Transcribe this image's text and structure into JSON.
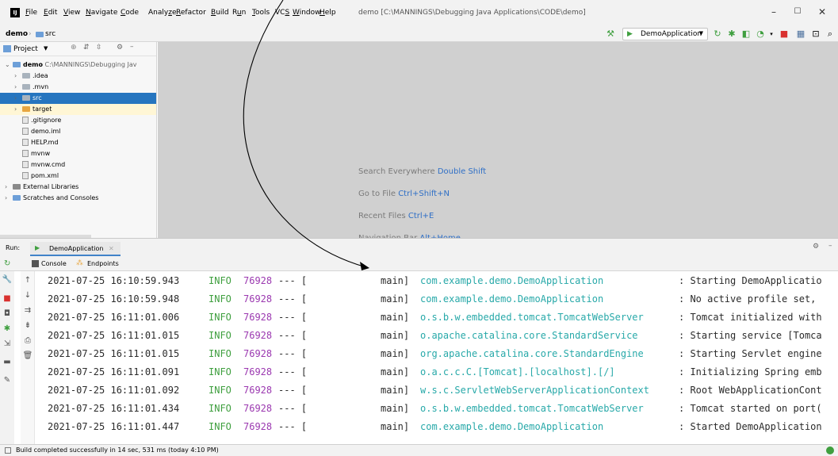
{
  "menu": {
    "items": [
      {
        "pre": "",
        "u": "F",
        "post": "ile"
      },
      {
        "pre": "",
        "u": "E",
        "post": "dit"
      },
      {
        "pre": "",
        "u": "V",
        "post": "iew"
      },
      {
        "pre": "",
        "u": "N",
        "post": "avigate"
      },
      {
        "pre": "",
        "u": "C",
        "post": "ode"
      },
      {
        "pre": "Analy",
        "u": "z",
        "post": "e"
      },
      {
        "pre": "",
        "u": "R",
        "post": "efactor"
      },
      {
        "pre": "",
        "u": "B",
        "post": "uild"
      },
      {
        "pre": "R",
        "u": "u",
        "post": "n"
      },
      {
        "pre": "",
        "u": "T",
        "post": "ools"
      },
      {
        "pre": "VC",
        "u": "S",
        "post": ""
      },
      {
        "pre": "",
        "u": "W",
        "post": "indow"
      },
      {
        "pre": "",
        "u": "H",
        "post": "elp"
      }
    ],
    "window_path": "demo [C:\\MANNINGS\\Debugging Java Applications\\CODE\\demo]",
    "minimize": "–",
    "maximize": "☐",
    "close": "✕"
  },
  "breadcrumb": {
    "project": "demo",
    "folder": "src"
  },
  "toolbar": {
    "run_config": "DemoApplication"
  },
  "project_panel": {
    "title": "Project",
    "rows": [
      {
        "label": "demo",
        "suffix": " C:\\MANNINGS\\Debugging Jav",
        "kind": "root"
      },
      {
        "label": ".idea",
        "kind": "folder"
      },
      {
        "label": ".mvn",
        "kind": "folder"
      },
      {
        "label": "src",
        "kind": "folder-selected"
      },
      {
        "label": "target",
        "kind": "folder-target"
      },
      {
        "label": ".gitignore",
        "kind": "file"
      },
      {
        "label": "demo.iml",
        "kind": "file"
      },
      {
        "label": "HELP.md",
        "kind": "file"
      },
      {
        "label": "mvnw",
        "kind": "file"
      },
      {
        "label": "mvnw.cmd",
        "kind": "file"
      },
      {
        "label": "pom.xml",
        "kind": "file"
      },
      {
        "label": "External Libraries",
        "kind": "lib"
      },
      {
        "label": "Scratches and Consoles",
        "kind": "scratch"
      }
    ]
  },
  "editor_hints": [
    {
      "text": "Search Everywhere ",
      "key": "Double Shift"
    },
    {
      "text": "Go to File ",
      "key": "Ctrl+Shift+N"
    },
    {
      "text": "Recent Files ",
      "key": "Ctrl+E"
    },
    {
      "text": "Navigation Bar ",
      "key": "Alt+Home"
    }
  ],
  "run_panel": {
    "label": "Run:",
    "tab": "DemoApplication",
    "subtabs": [
      "Console",
      "Endpoints"
    ]
  },
  "log": [
    {
      "time": "2021-07-25 16:10:59.943",
      "level": "INFO",
      "pid": "76928",
      "sep": "--- [",
      "thread": "main]",
      "logger": "com.example.demo.DemoApplication",
      "msg": ": Starting DemoApplicatio"
    },
    {
      "time": "2021-07-25 16:10:59.948",
      "level": "INFO",
      "pid": "76928",
      "sep": "--- [",
      "thread": "main]",
      "logger": "com.example.demo.DemoApplication",
      "msg": ": No active profile set,"
    },
    {
      "time": "2021-07-25 16:11:01.006",
      "level": "INFO",
      "pid": "76928",
      "sep": "--- [",
      "thread": "main]",
      "logger": "o.s.b.w.embedded.tomcat.TomcatWebServer",
      "msg": ": Tomcat initialized with"
    },
    {
      "time": "2021-07-25 16:11:01.015",
      "level": "INFO",
      "pid": "76928",
      "sep": "--- [",
      "thread": "main]",
      "logger": "o.apache.catalina.core.StandardService",
      "msg": ": Starting service [Tomca"
    },
    {
      "time": "2021-07-25 16:11:01.015",
      "level": "INFO",
      "pid": "76928",
      "sep": "--- [",
      "thread": "main]",
      "logger": "org.apache.catalina.core.StandardEngine",
      "msg": ": Starting Servlet engine"
    },
    {
      "time": "2021-07-25 16:11:01.091",
      "level": "INFO",
      "pid": "76928",
      "sep": "--- [",
      "thread": "main]",
      "logger": "o.a.c.c.C.[Tomcat].[localhost].[/]",
      "msg": ": Initializing Spring emb"
    },
    {
      "time": "2021-07-25 16:11:01.092",
      "level": "INFO",
      "pid": "76928",
      "sep": "--- [",
      "thread": "main]",
      "logger": "w.s.c.ServletWebServerApplicationContext",
      "msg": ": Root WebApplicationCont"
    },
    {
      "time": "2021-07-25 16:11:01.434",
      "level": "INFO",
      "pid": "76928",
      "sep": "--- [",
      "thread": "main]",
      "logger": "o.s.b.w.embedded.tomcat.TomcatWebServer",
      "msg": ": Tomcat started on port("
    },
    {
      "time": "2021-07-25 16:11:01.447",
      "level": "INFO",
      "pid": "76928",
      "sep": "--- [",
      "thread": "main]",
      "logger": "com.example.demo.DemoApplication",
      "msg": ": Started DemoApplication"
    }
  ],
  "status": {
    "message": "Build completed successfully in 14 sec, 531 ms (today 4:10 PM)"
  },
  "colors": {
    "selection": "#2675bf",
    "logger": "#28a9a9",
    "info": "#3f9f3f",
    "pid": "#9b38b0",
    "run_green": "#3f9f3f",
    "stop_red": "#d9312f"
  }
}
